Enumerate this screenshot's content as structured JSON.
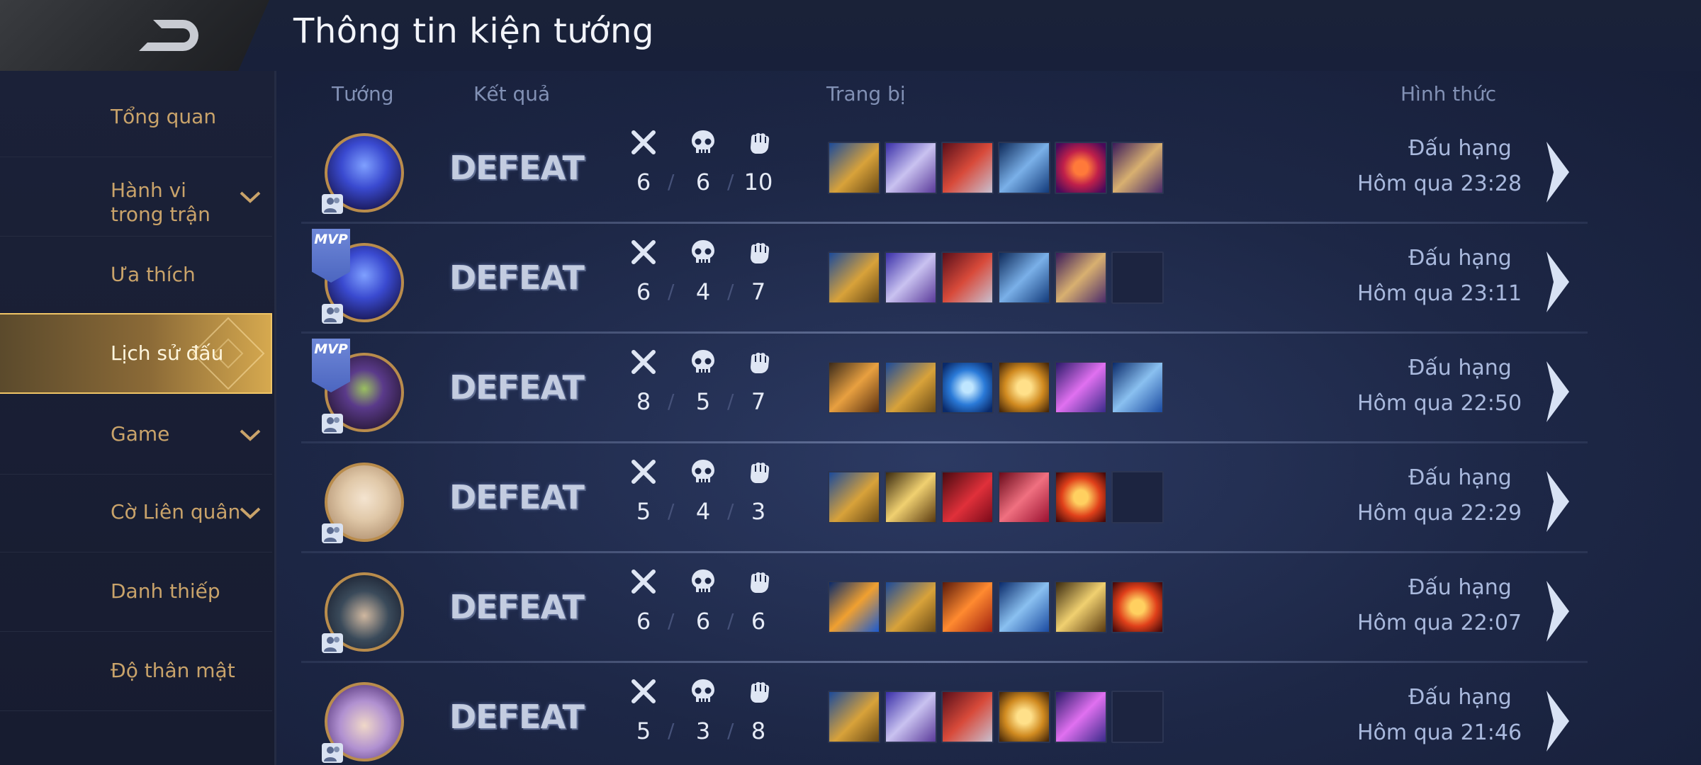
{
  "header": {
    "title": "Thông tin kiện tướng"
  },
  "sidebar": {
    "items": [
      {
        "label": "Tổng quan",
        "has_dropdown": false,
        "active": false
      },
      {
        "label": "Hành vi trong trận",
        "has_dropdown": true,
        "active": false
      },
      {
        "label": "Ưa thích",
        "has_dropdown": false,
        "active": false
      },
      {
        "label": "Lịch sử đấu",
        "has_dropdown": false,
        "active": true
      },
      {
        "label": "Game",
        "has_dropdown": true,
        "active": false
      },
      {
        "label": "Cờ Liên quân",
        "has_dropdown": true,
        "active": false
      },
      {
        "label": "Danh thiếp",
        "has_dropdown": false,
        "active": false
      },
      {
        "label": "Độ thân mật",
        "has_dropdown": false,
        "active": false
      }
    ]
  },
  "table": {
    "columns": {
      "hero": "Tướng",
      "result": "Kết quả",
      "items": "Trang bị",
      "mode": "Hình thức"
    },
    "rows": [
      {
        "hero_icon": "hero-portrait-blue",
        "mvp": false,
        "mvp_label": "",
        "result": "DEFEAT",
        "kills": "6",
        "deaths": "6",
        "assists": "10",
        "items": [
          "boots",
          "spellbook",
          "red-armor",
          "blue-ring",
          "crimson-orb",
          "scroll"
        ],
        "mode": "Đấu hạng",
        "time": "Hôm qua 23:28"
      },
      {
        "hero_icon": "hero-portrait-blue",
        "mvp": true,
        "mvp_label": "MVP",
        "result": "DEFEAT",
        "kills": "6",
        "deaths": "4",
        "assists": "7",
        "items": [
          "boots",
          "spellbook",
          "red-armor",
          "blue-ring",
          "scroll",
          "empty"
        ],
        "mode": "Đấu hạng",
        "time": "Hôm qua 23:11"
      },
      {
        "hero_icon": "hero-portrait-masked",
        "mvp": true,
        "mvp_label": "MVP",
        "result": "DEFEAT",
        "kills": "8",
        "deaths": "5",
        "assists": "7",
        "items": [
          "golden-sword",
          "boots",
          "blue-orb",
          "gold-crown",
          "purple-staff",
          "blue-coat"
        ],
        "mode": "Đấu hạng",
        "time": "Hôm qua 22:50"
      },
      {
        "hero_icon": "hero-portrait-blonde",
        "mvp": false,
        "mvp_label": "",
        "result": "DEFEAT",
        "kills": "5",
        "deaths": "4",
        "assists": "3",
        "items": [
          "boots",
          "holy-sword",
          "red-slash",
          "crimson-blade",
          "fire-ring",
          "empty"
        ],
        "mode": "Đấu hạng",
        "time": "Hôm qua 22:29"
      },
      {
        "hero_icon": "hero-portrait-hat",
        "mvp": false,
        "mvp_label": "",
        "result": "DEFEAT",
        "kills": "6",
        "deaths": "6",
        "assists": "6",
        "items": [
          "lightning-blade",
          "boots",
          "fire-claw",
          "blue-coat",
          "holy-sword",
          "fire-ring"
        ],
        "mode": "Đấu hạng",
        "time": "Hôm qua 22:07"
      },
      {
        "hero_icon": "hero-portrait-knight",
        "mvp": false,
        "mvp_label": "",
        "result": "DEFEAT",
        "kills": "5",
        "deaths": "3",
        "assists": "8",
        "items": [
          "boots",
          "spellbook",
          "red-armor",
          "gold-crown",
          "purple-staff",
          "empty"
        ],
        "mode": "Đấu hạng",
        "time": "Hôm qua 21:46"
      }
    ]
  },
  "icons": {
    "kills": "crossed-swords-icon",
    "deaths": "skull-icon",
    "assists": "fist-icon"
  },
  "colors": {
    "accent_gold": "#d6a94f",
    "sidebar_text": "#c9a36a",
    "defeat_text": "#c3cce0"
  }
}
